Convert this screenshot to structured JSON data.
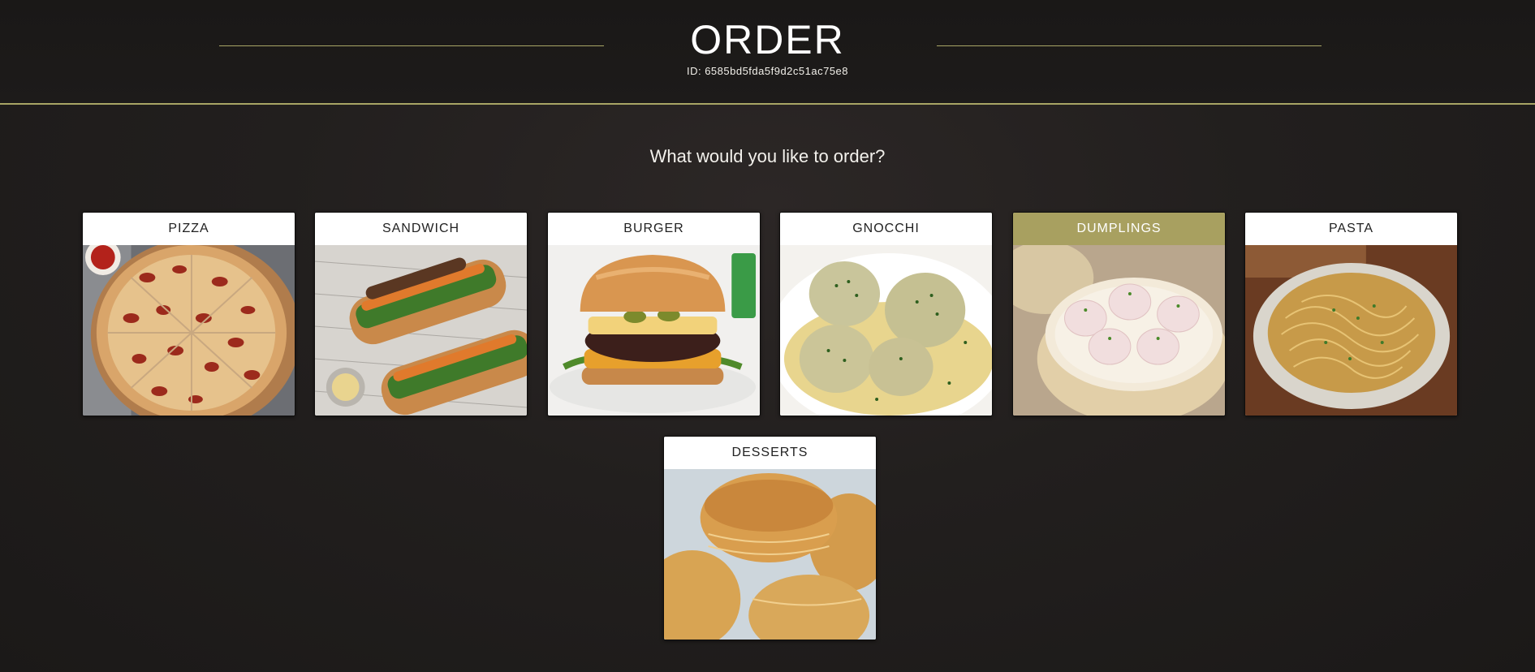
{
  "header": {
    "title": "ORDER",
    "order_id": "ID: 6585bd5fda5f9d2c51ac75e8"
  },
  "prompt": "What would you like to order?",
  "categories": [
    {
      "label": "PIZZA",
      "icon": "pizza-image"
    },
    {
      "label": "SANDWICH",
      "icon": "sandwich-image"
    },
    {
      "label": "BURGER",
      "icon": "burger-image"
    },
    {
      "label": "GNOCCHI",
      "icon": "gnocchi-image"
    },
    {
      "label": "DUMPLINGS",
      "icon": "dumplings-image",
      "selected": true
    },
    {
      "label": "PASTA",
      "icon": "pasta-image"
    },
    {
      "label": "DESSERTS",
      "icon": "desserts-image"
    }
  ],
  "colors": {
    "accent": "#a8a565",
    "selected_label_bg": "#a8a060",
    "background": "#221f1e"
  }
}
